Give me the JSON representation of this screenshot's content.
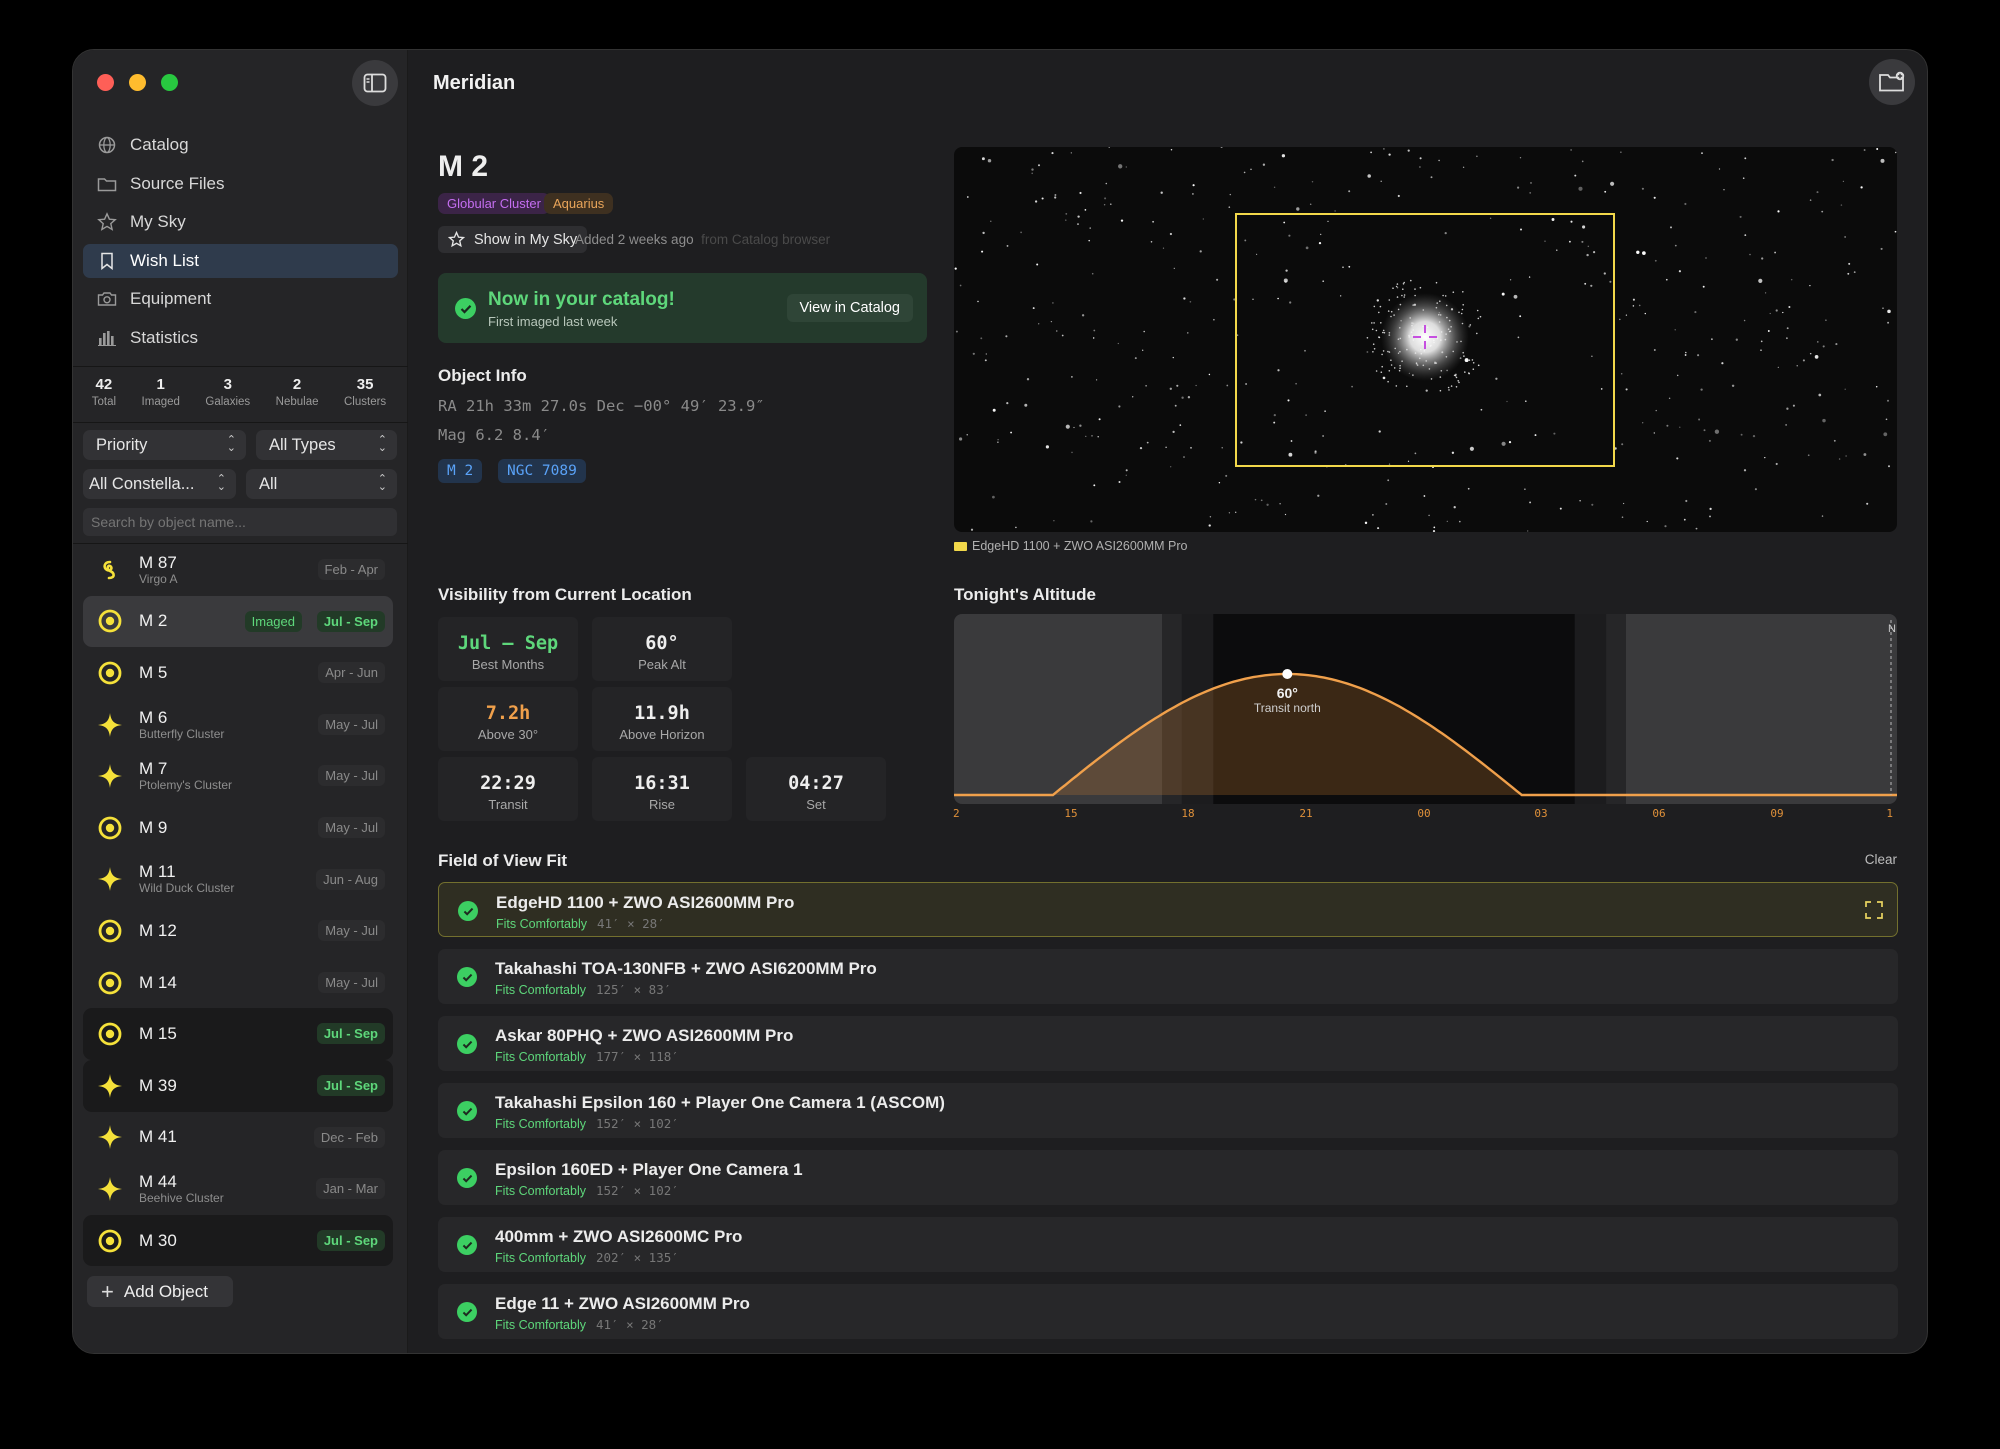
{
  "app": {
    "title": "Meridian"
  },
  "sidebar": {
    "nav": [
      {
        "label": "Catalog",
        "icon": "globe-icon"
      },
      {
        "label": "Source Files",
        "icon": "folder-icon"
      },
      {
        "label": "My Sky",
        "icon": "star-icon"
      },
      {
        "label": "Wish List",
        "icon": "bookmark-icon",
        "active": true
      },
      {
        "label": "Equipment",
        "icon": "camera-icon"
      },
      {
        "label": "Statistics",
        "icon": "chart-icon"
      }
    ],
    "stats": [
      {
        "value": "42",
        "label": "Total"
      },
      {
        "value": "1",
        "label": "Imaged"
      },
      {
        "value": "3",
        "label": "Galaxies"
      },
      {
        "value": "2",
        "label": "Nebulae"
      },
      {
        "value": "35",
        "label": "Clusters"
      }
    ],
    "filters": {
      "sort": "Priority",
      "type": "All Types",
      "constellation": "All Constella...",
      "status": "All"
    },
    "search_placeholder": "Search by object name...",
    "objects": [
      {
        "name": "M 87",
        "sub": "Virgo A",
        "months": "Feb - Apr",
        "icon": "galaxy-icon",
        "highlight": false
      },
      {
        "name": "M 2",
        "sub": "",
        "months": "Jul - Sep",
        "icon": "globular-cluster-icon",
        "highlight": true,
        "badge": "Imaged"
      },
      {
        "name": "M 5",
        "sub": "",
        "months": "Apr - Jun",
        "icon": "globular-cluster-icon",
        "highlight": false
      },
      {
        "name": "M 6",
        "sub": "Butterfly Cluster",
        "months": "May - Jul",
        "icon": "open-cluster-icon",
        "highlight": false
      },
      {
        "name": "M 7",
        "sub": "Ptolemy's Cluster",
        "months": "May - Jul",
        "icon": "open-cluster-icon",
        "highlight": false
      },
      {
        "name": "M 9",
        "sub": "",
        "months": "May - Jul",
        "icon": "globular-cluster-icon",
        "highlight": false
      },
      {
        "name": "M 11",
        "sub": "Wild Duck Cluster",
        "months": "Jun - Aug",
        "icon": "open-cluster-icon",
        "highlight": false
      },
      {
        "name": "M 12",
        "sub": "",
        "months": "May - Jul",
        "icon": "globular-cluster-icon",
        "highlight": false
      },
      {
        "name": "M 14",
        "sub": "",
        "months": "May - Jul",
        "icon": "globular-cluster-icon",
        "highlight": false
      },
      {
        "name": "M 15",
        "sub": "",
        "months": "Jul - Sep",
        "icon": "globular-cluster-icon",
        "highlight": true
      },
      {
        "name": "M 39",
        "sub": "",
        "months": "Jul - Sep",
        "icon": "open-cluster-icon",
        "highlight": true
      },
      {
        "name": "M 41",
        "sub": "",
        "months": "Dec - Feb",
        "icon": "open-cluster-icon",
        "highlight": false
      },
      {
        "name": "M 44",
        "sub": "Beehive Cluster",
        "months": "Jan - Mar",
        "icon": "open-cluster-icon",
        "highlight": false
      },
      {
        "name": "M 30",
        "sub": "",
        "months": "Jul - Sep",
        "icon": "globular-cluster-icon",
        "highlight": true
      }
    ],
    "add_label": "Add Object"
  },
  "object": {
    "name": "M 2",
    "type_tag": "Globular Cluster",
    "constellation_tag": "Aquarius",
    "show_sky_label": "Show in My Sky",
    "added_text": "Added 2 weeks ago",
    "added_source": "from Catalog browser",
    "banner": {
      "title": "Now in your catalog!",
      "subtitle": "First imaged last week",
      "button": "View in Catalog"
    },
    "info_title": "Object Info",
    "coords": "RA 21h 33m 27.0s  Dec −00° 49′ 23.9″",
    "mag": "Mag 6.2  8.4′",
    "designations": [
      "M 2",
      "NGC 7089"
    ],
    "image_caption": "EdgeHD 1100 + ZWO ASI2600MM Pro"
  },
  "visibility": {
    "title": "Visibility from Current Location",
    "cells": [
      {
        "value": "Jul – Sep",
        "label": "Best Months",
        "color": "#5ed77b"
      },
      {
        "value": "60°",
        "label": "Peak Alt",
        "color": "#eeeeee"
      },
      {
        "value": "7.2h",
        "label": "Above 30°",
        "color": "#f0a04b"
      },
      {
        "value": "11.9h",
        "label": "Above Horizon",
        "color": "#eeeeee"
      },
      {
        "value": "22:29",
        "label": "Transit",
        "color": "#eeeeee"
      },
      {
        "value": "16:31",
        "label": "Rise",
        "color": "#eeeeee"
      },
      {
        "value": "04:27",
        "label": "Set",
        "color": "#eeeeee"
      }
    ]
  },
  "altitude": {
    "title": "Tonight's Altitude",
    "peak_label": "60°",
    "peak_sub": "Transit north",
    "ticks": [
      "2",
      "15",
      "18",
      "21",
      "00",
      "03",
      "06",
      "09",
      "1"
    ],
    "marker": "N"
  },
  "chart_data": {
    "type": "area",
    "title": "Tonight's Altitude",
    "x": [
      "15",
      "18",
      "21",
      "00",
      "03",
      "06",
      "09"
    ],
    "peak": {
      "time": "22:29",
      "altitude": 60
    },
    "rise": "16:31",
    "set": "04:27"
  },
  "fov": {
    "title": "Field of View Fit",
    "clear_label": "Clear",
    "rows": [
      {
        "name": "EdgeHD 1100 + ZWO ASI2600MM Pro",
        "status": "Fits Comfortably",
        "dims": "41′ × 28′",
        "selected": true
      },
      {
        "name": "Takahashi TOA-130NFB + ZWO ASI6200MM Pro",
        "status": "Fits Comfortably",
        "dims": "125′ × 83′"
      },
      {
        "name": "Askar 80PHQ + ZWO ASI2600MM Pro",
        "status": "Fits Comfortably",
        "dims": "177′ × 118′"
      },
      {
        "name": "Takahashi Epsilon 160 + Player One Camera 1 (ASCOM)",
        "status": "Fits Comfortably",
        "dims": "152′ × 102′"
      },
      {
        "name": "Epsilon 160ED + Player One Camera 1",
        "status": "Fits Comfortably",
        "dims": "152′ × 102′"
      },
      {
        "name": "400mm + ZWO ASI2600MC Pro",
        "status": "Fits Comfortably",
        "dims": "202′ × 135′"
      },
      {
        "name": "Edge 11 + ZWO ASI2600MM Pro",
        "status": "Fits Comfortably",
        "dims": "41′ × 28′"
      }
    ]
  }
}
